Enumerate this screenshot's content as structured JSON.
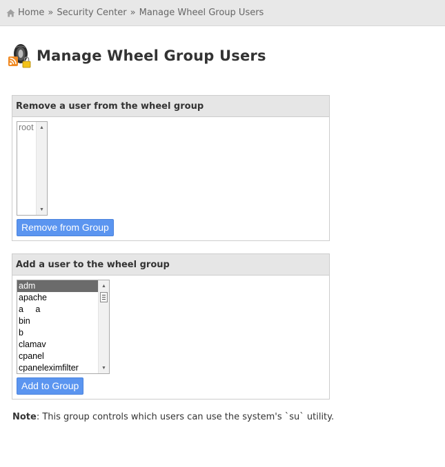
{
  "breadcrumb": {
    "home": "Home",
    "separator": "»",
    "security_center": "Security Center",
    "current": "Manage Wheel Group Users"
  },
  "page": {
    "title": "Manage Wheel Group Users",
    "icon": "wheel-lock-icon"
  },
  "remove_panel": {
    "heading": "Remove a user from the wheel group",
    "users": [
      "root"
    ],
    "button_label": "Remove from Group"
  },
  "add_panel": {
    "heading": "Add a user to the wheel group",
    "users": [
      "adm",
      "apache",
      "a     a",
      "bin",
      "b",
      "clamav",
      "cpanel",
      "cpaneleximfilter"
    ],
    "selected_user": "adm",
    "button_label": "Add to Group"
  },
  "note": {
    "label": "Note",
    "text": ": This group controls which users can use the system's `su` utility."
  },
  "colors": {
    "button_bg": "#5b95f0",
    "panel_header_bg": "#e6e6e6",
    "breadcrumb_bg": "#e8e8e8",
    "selected_item_bg": "#6b6b6b"
  }
}
